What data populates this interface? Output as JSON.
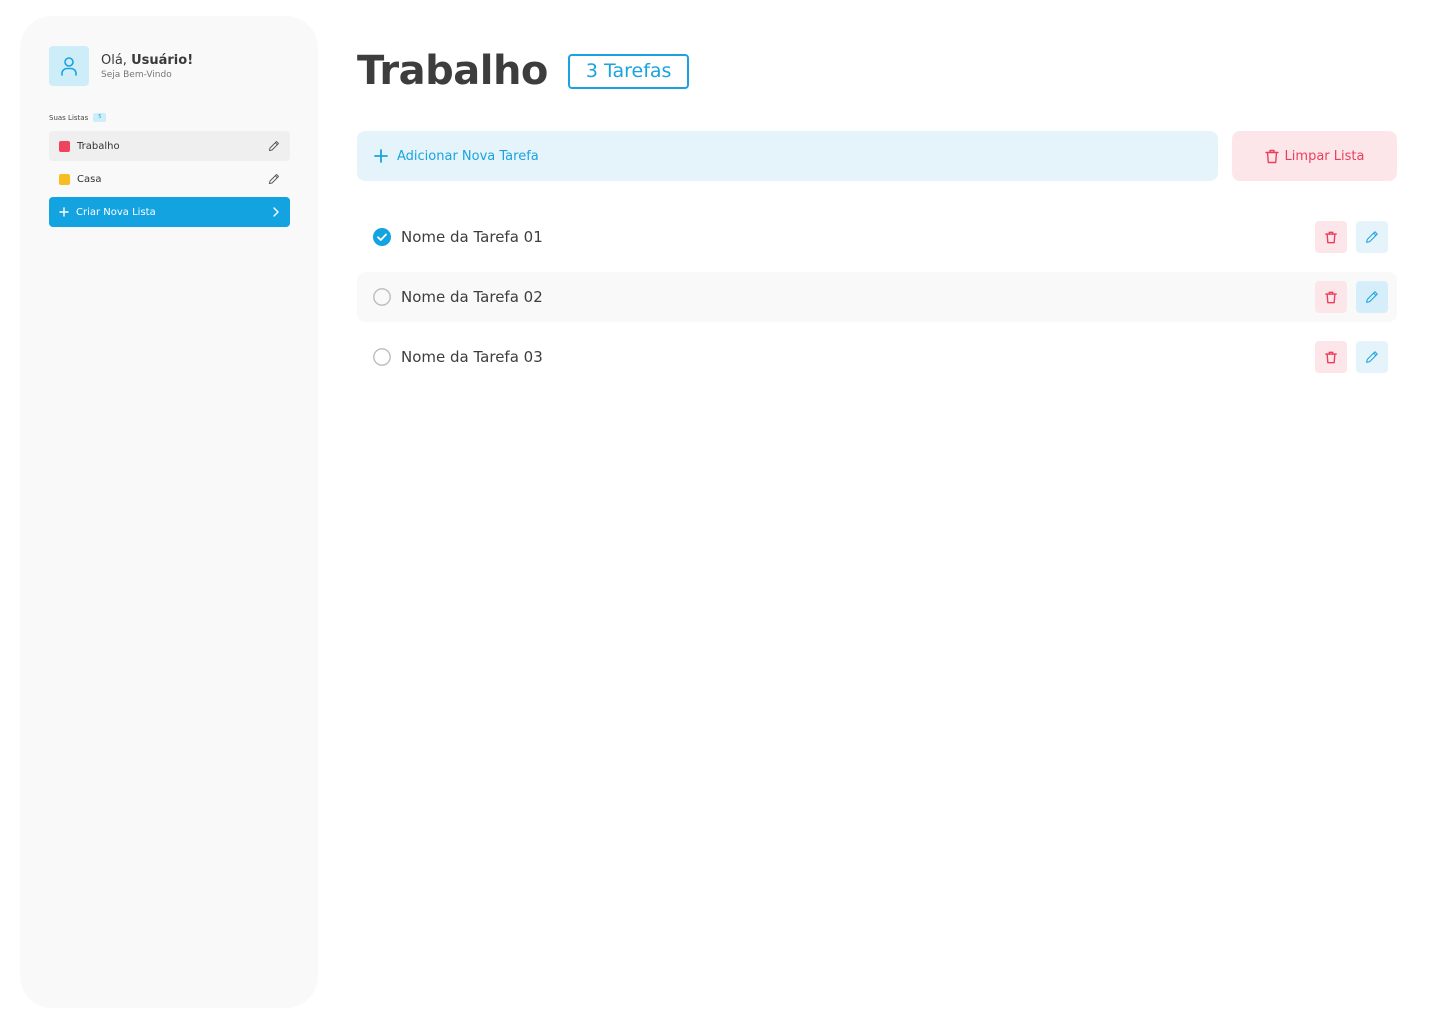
{
  "colors": {
    "accent": "#14a3e1",
    "danger": "#ec3e5c",
    "list_trabalho": "#f0435e",
    "list_casa": "#f7be22"
  },
  "user": {
    "greeting": "Olá, ",
    "name": "Usuário!",
    "welcome": "Seja Bem-Vindo",
    "avatar_icon": "user-icon"
  },
  "sidebar": {
    "lists_title": "Suas Listas",
    "lists_count": "5",
    "lists": [
      {
        "label": "Trabalho",
        "color": "#f0435e",
        "active": true
      },
      {
        "label": "Casa",
        "color": "#f7be22",
        "active": false
      }
    ],
    "new_list_label": "Criar Nova Lista"
  },
  "main": {
    "title": "Trabalho",
    "count_badge": "3 Tarefas",
    "add_task_label": "Adicionar Nova Tarefa",
    "clear_list_label": "Limpar Lista",
    "tasks": [
      {
        "name": "Nome da Tarefa 01",
        "done": true
      },
      {
        "name": "Nome da Tarefa 02",
        "done": false
      },
      {
        "name": "Nome da Tarefa 03",
        "done": false
      }
    ]
  }
}
